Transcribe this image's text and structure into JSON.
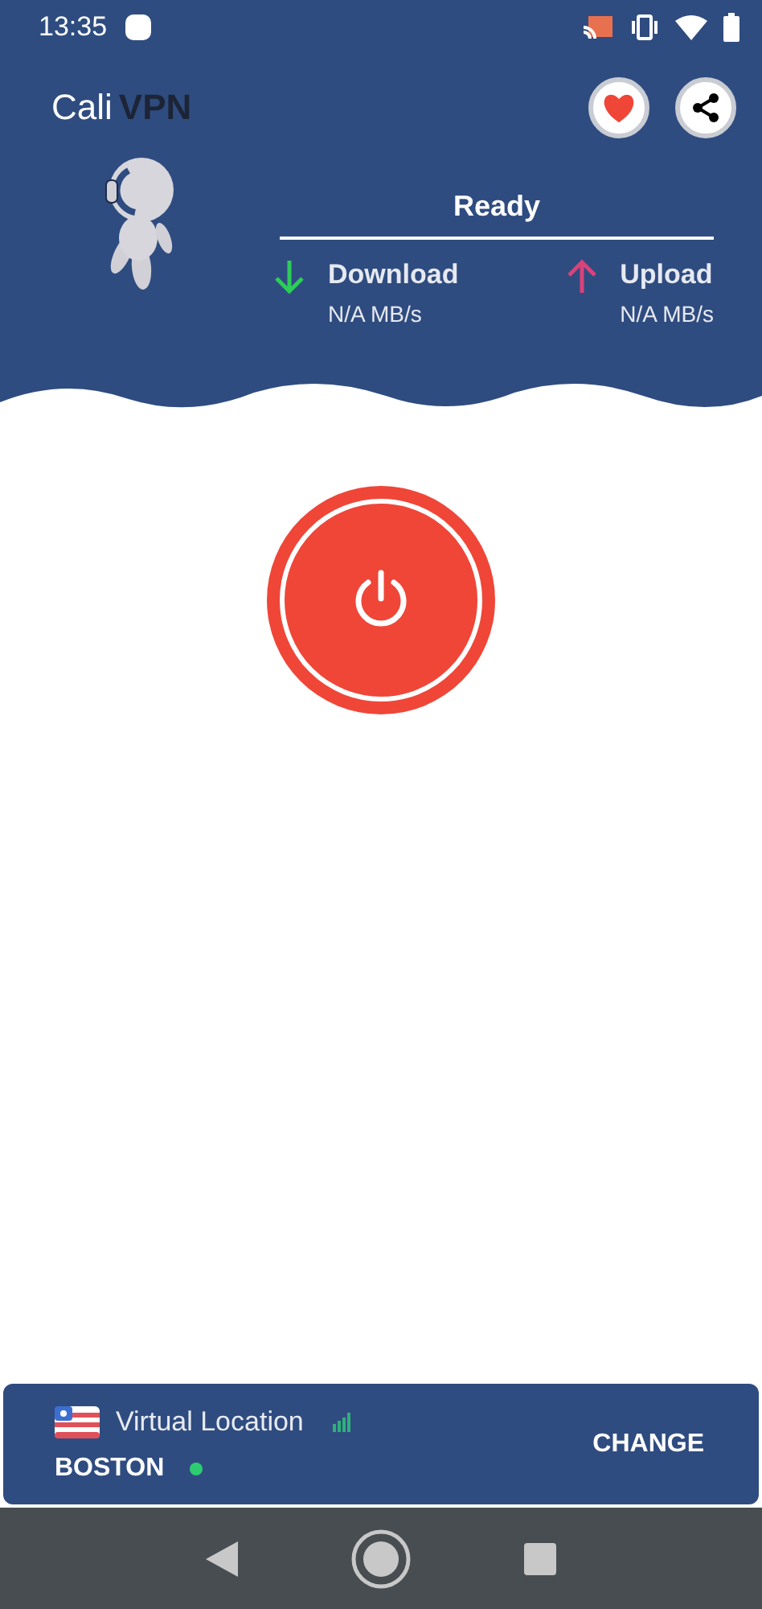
{
  "status_bar": {
    "time": "13:35"
  },
  "header": {
    "brand": [
      "Cali",
      "VPN"
    ],
    "status": "Ready",
    "stats": [
      {
        "kind": "download",
        "label": "Download",
        "value": "N/A MB/s"
      },
      {
        "kind": "upload",
        "label": "Upload",
        "value": "N/A MB/s"
      }
    ]
  },
  "power": {
    "on": false
  },
  "location": {
    "title": "Virtual Location",
    "city": "BOSTON",
    "online": true,
    "action": "CHANGE"
  }
}
